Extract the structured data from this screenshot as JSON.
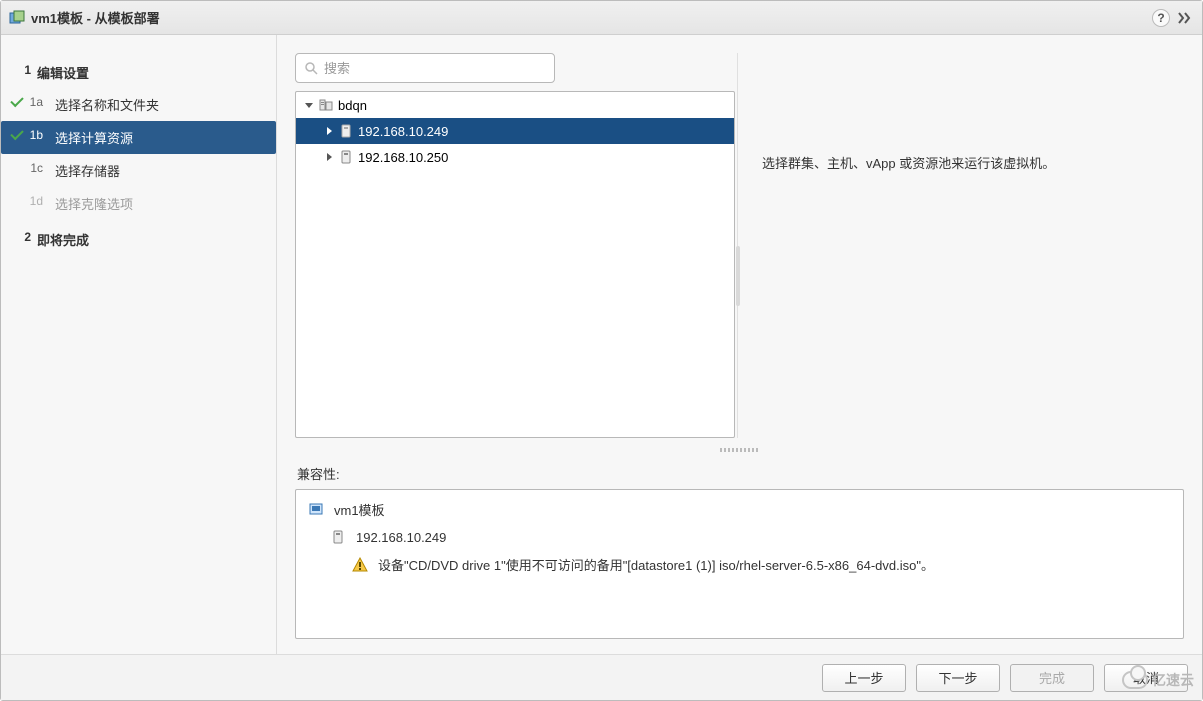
{
  "title": "vm1模板 - 从模板部署",
  "sidebar": {
    "groups": [
      {
        "num": "1",
        "label": "编辑设置",
        "items": [
          {
            "code": "1a",
            "label": "选择名称和文件夹",
            "state": "done"
          },
          {
            "code": "1b",
            "label": "选择计算资源",
            "state": "active"
          },
          {
            "code": "1c",
            "label": "选择存储器",
            "state": "normal"
          },
          {
            "code": "1d",
            "label": "选择克隆选项",
            "state": "disabled"
          }
        ]
      },
      {
        "num": "2",
        "label": "即将完成",
        "items": []
      }
    ]
  },
  "search": {
    "placeholder": "搜索"
  },
  "tree": {
    "root": {
      "label": "bdqn",
      "icon": "datacenter"
    },
    "hosts": [
      {
        "label": "192.168.10.249",
        "selected": true
      },
      {
        "label": "192.168.10.250",
        "selected": false
      }
    ]
  },
  "description": "选择群集、主机、vApp 或资源池来运行该虚拟机。",
  "compat": {
    "label": "兼容性:",
    "vm_name": "vm1模板",
    "host": "192.168.10.249",
    "warning": "设备\"CD/DVD drive 1\"使用不可访问的备用\"[datastore1 (1)] iso/rhel-server-6.5-x86_64-dvd.iso\"。"
  },
  "buttons": {
    "back": "上一步",
    "next": "下一步",
    "finish": "完成",
    "cancel": "取消"
  },
  "watermark": "亿速云"
}
